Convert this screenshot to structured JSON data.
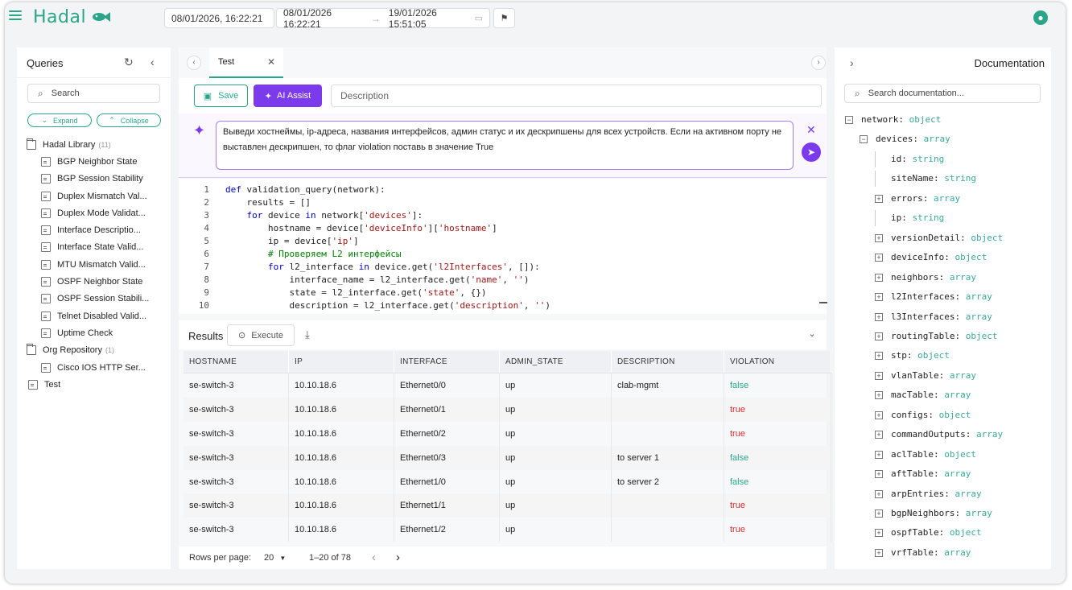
{
  "app": {
    "name": "Hadal"
  },
  "topbar": {
    "date_single": "08/01/2026, 16:22:21",
    "range_start": "08/01/2026 16:22:21",
    "range_sep": "→",
    "range_end": "19/01/2026 15:51:05"
  },
  "queries": {
    "title": "Queries",
    "search_placeholder": "Search",
    "expand_label": "Expand",
    "collapse_label": "Collapse",
    "tree": [
      {
        "label": "Hadal Library",
        "count": "(11)",
        "type": "folder",
        "level": 0
      },
      {
        "label": "BGP Neighbor State",
        "type": "file",
        "level": 1
      },
      {
        "label": "BGP Session Stability",
        "type": "file",
        "level": 1
      },
      {
        "label": "Duplex Mismatch Val...",
        "type": "file",
        "level": 1
      },
      {
        "label": "Duplex Mode Validat...",
        "type": "file",
        "level": 1
      },
      {
        "label": "Interface Descriptio...",
        "type": "file",
        "level": 1
      },
      {
        "label": "Interface State Valid...",
        "type": "file",
        "level": 1
      },
      {
        "label": "MTU Mismatch Valid...",
        "type": "file",
        "level": 1
      },
      {
        "label": "OSPF Neighbor State",
        "type": "file",
        "level": 1
      },
      {
        "label": "OSPF Session Stabili...",
        "type": "file",
        "level": 1
      },
      {
        "label": "Telnet Disabled Valid...",
        "type": "file",
        "level": 1
      },
      {
        "label": "Uptime Check",
        "type": "file",
        "level": 1
      },
      {
        "label": "Org Repository",
        "count": "(1)",
        "type": "folder",
        "level": 0
      },
      {
        "label": "Cisco IOS HTTP Ser...",
        "type": "file",
        "level": 1
      },
      {
        "label": "Test",
        "type": "file",
        "level": 0
      }
    ]
  },
  "editor": {
    "tab_label": "Test",
    "save_label": "Save",
    "ai_label": "AI Assist",
    "description_placeholder": "Description",
    "ai_prompt": "Выведи хостнеймы, ip-адреса, названия интерфейсов, админ статус и их дескрипшены для всех устройств. Если на активном порту не выставлен дескрипшен, то флаг violation поставь в значение True",
    "code_lines": [
      "def validation_query(network):",
      "    results = []",
      "    for device in network['devices']:",
      "        hostname = device['deviceInfo']['hostname']",
      "        ip = device['ip']",
      "        # Проверяем L2 интерфейсы",
      "        for l2_interface in device.get('l2Interfaces', []):",
      "            interface_name = l2_interface.get('name', '')",
      "            state = l2_interface.get('state', {})",
      "            description = l2_interface.get('description', '')"
    ]
  },
  "results": {
    "title": "Results",
    "execute_label": "Execute",
    "columns": [
      "HOSTNAME",
      "IP",
      "INTERFACE",
      "ADMIN_STATE",
      "DESCRIPTION",
      "VIOLATION"
    ],
    "rows": [
      [
        "se-switch-3",
        "10.10.18.6",
        "Ethernet0/0",
        "up",
        "clab-mgmt",
        "false"
      ],
      [
        "se-switch-3",
        "10.10.18.6",
        "Ethernet0/1",
        "up",
        "",
        "true"
      ],
      [
        "se-switch-3",
        "10.10.18.6",
        "Ethernet0/2",
        "up",
        "",
        "true"
      ],
      [
        "se-switch-3",
        "10.10.18.6",
        "Ethernet0/3",
        "up",
        "to server 1",
        "false"
      ],
      [
        "se-switch-3",
        "10.10.18.6",
        "Ethernet1/0",
        "up",
        "to server 2",
        "false"
      ],
      [
        "se-switch-3",
        "10.10.18.6",
        "Ethernet1/1",
        "up",
        "",
        "true"
      ],
      [
        "se-switch-3",
        "10.10.18.6",
        "Ethernet1/2",
        "up",
        "",
        "true"
      ]
    ],
    "rows_per_page_label": "Rows per page:",
    "rows_per_page": "20",
    "range": "1–20 of 78"
  },
  "documentation": {
    "title": "Documentation",
    "search_placeholder": "Search documentation...",
    "tree": [
      {
        "key": "network:",
        "type": "object",
        "level": 0,
        "toggle": "minus"
      },
      {
        "key": "devices:",
        "type": "array",
        "level": 1,
        "toggle": "minus"
      },
      {
        "key": "id:",
        "type": "string",
        "level": 2,
        "toggle": "none"
      },
      {
        "key": "siteName:",
        "type": "string",
        "level": 2,
        "toggle": "none"
      },
      {
        "key": "errors:",
        "type": "array",
        "level": 2,
        "toggle": "plus"
      },
      {
        "key": "ip:",
        "type": "string",
        "level": 2,
        "toggle": "none"
      },
      {
        "key": "versionDetail:",
        "type": "object",
        "level": 2,
        "toggle": "plus"
      },
      {
        "key": "deviceInfo:",
        "type": "object",
        "level": 2,
        "toggle": "plus"
      },
      {
        "key": "neighbors:",
        "type": "array",
        "level": 2,
        "toggle": "plus"
      },
      {
        "key": "l2Interfaces:",
        "type": "array",
        "level": 2,
        "toggle": "plus"
      },
      {
        "key": "l3Interfaces:",
        "type": "array",
        "level": 2,
        "toggle": "plus"
      },
      {
        "key": "routingTable:",
        "type": "object",
        "level": 2,
        "toggle": "plus"
      },
      {
        "key": "stp:",
        "type": "object",
        "level": 2,
        "toggle": "plus"
      },
      {
        "key": "vlanTable:",
        "type": "array",
        "level": 2,
        "toggle": "plus"
      },
      {
        "key": "macTable:",
        "type": "array",
        "level": 2,
        "toggle": "plus"
      },
      {
        "key": "configs:",
        "type": "object",
        "level": 2,
        "toggle": "plus"
      },
      {
        "key": "commandOutputs:",
        "type": "array",
        "level": 2,
        "toggle": "plus"
      },
      {
        "key": "aclTable:",
        "type": "object",
        "level": 2,
        "toggle": "plus"
      },
      {
        "key": "aftTable:",
        "type": "array",
        "level": 2,
        "toggle": "plus"
      },
      {
        "key": "arpEntries:",
        "type": "array",
        "level": 2,
        "toggle": "plus"
      },
      {
        "key": "bgpNeighbors:",
        "type": "array",
        "level": 2,
        "toggle": "plus"
      },
      {
        "key": "ospfTable:",
        "type": "object",
        "level": 2,
        "toggle": "plus"
      },
      {
        "key": "vrfTable:",
        "type": "array",
        "level": 2,
        "toggle": "plus"
      }
    ]
  },
  "colors": {
    "accent": "#2aa58a",
    "ai": "#7c3aed",
    "error": "#d32f2f"
  }
}
